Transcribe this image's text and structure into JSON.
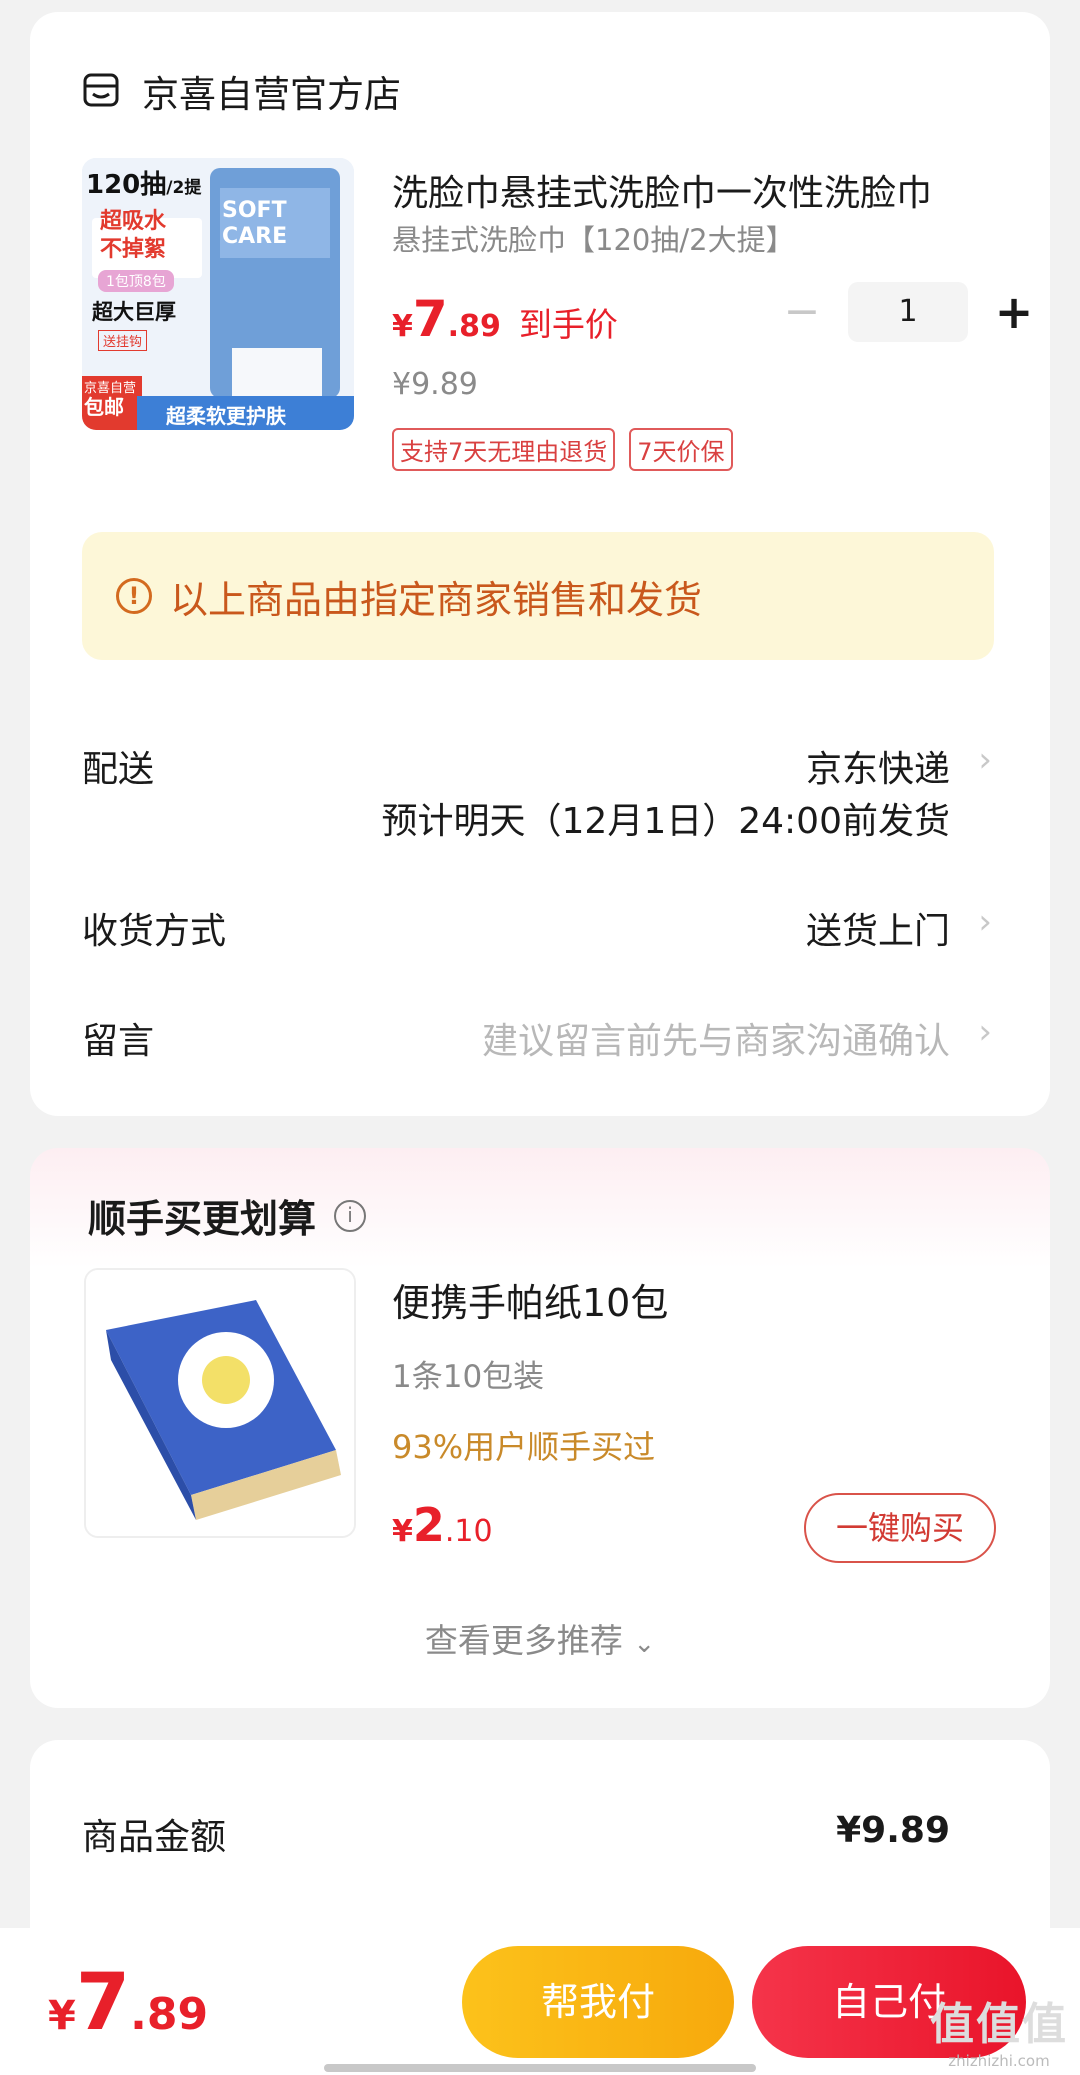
{
  "store": {
    "name": "京喜自营官方店"
  },
  "product": {
    "title": "洗脸巾悬挂式洗脸巾一次性洗脸巾",
    "spec": "悬挂式洗脸巾【120抽/2大提】",
    "price_yen": "¥",
    "price_int": "7",
    "price_dec": ".89",
    "price_tag": "到手价",
    "orig_price": "¥9.89",
    "quantity": "1",
    "tags": [
      "支持7天无理由退货",
      "7天价保"
    ],
    "image_text": {
      "top": "120抽",
      "top_sub": "/2提",
      "line1": "超吸水",
      "line2": "不掉絮",
      "pill": "1包顶8包",
      "thick": "超大巨厚",
      "gift": "送挂钩",
      "brand": "SOFT CARE",
      "badge1": "京喜自营",
      "badge2": "包邮",
      "bottom": "超柔软更护肤"
    }
  },
  "notice": {
    "icon": "info-icon",
    "text": "以上商品由指定商家销售和发货"
  },
  "delivery": {
    "label": "配送",
    "value": "京东快递",
    "eta": "预计明天（12月1日）24:00前发货"
  },
  "receive": {
    "label": "收货方式",
    "value": "送货上门"
  },
  "message": {
    "label": "留言",
    "placeholder": "建议留言前先与商家沟通确认"
  },
  "recommend": {
    "title": "顺手买更划算",
    "item": {
      "name": "便携手帕纸10包",
      "spec": "1条10包装",
      "social": "93%用户顺手买过",
      "price_yen": "¥",
      "price_int": "2",
      "price_dec": ".10",
      "button": "一键购买"
    },
    "more": "查看更多推荐"
  },
  "summary": {
    "label": "商品金额",
    "value": "¥9.89"
  },
  "bottom": {
    "yen": "¥",
    "int": "7",
    "dec": ".89",
    "help_pay": "帮我付",
    "self_pay": "自己付",
    "watermark": "值值值",
    "watermark_sub": "zhizhizhi.com"
  },
  "colors": {
    "accent": "#e8202a",
    "notice_bg": "#fdf7d8",
    "help_btn": "#fcc21b",
    "self_btn": "#f02a3c"
  }
}
